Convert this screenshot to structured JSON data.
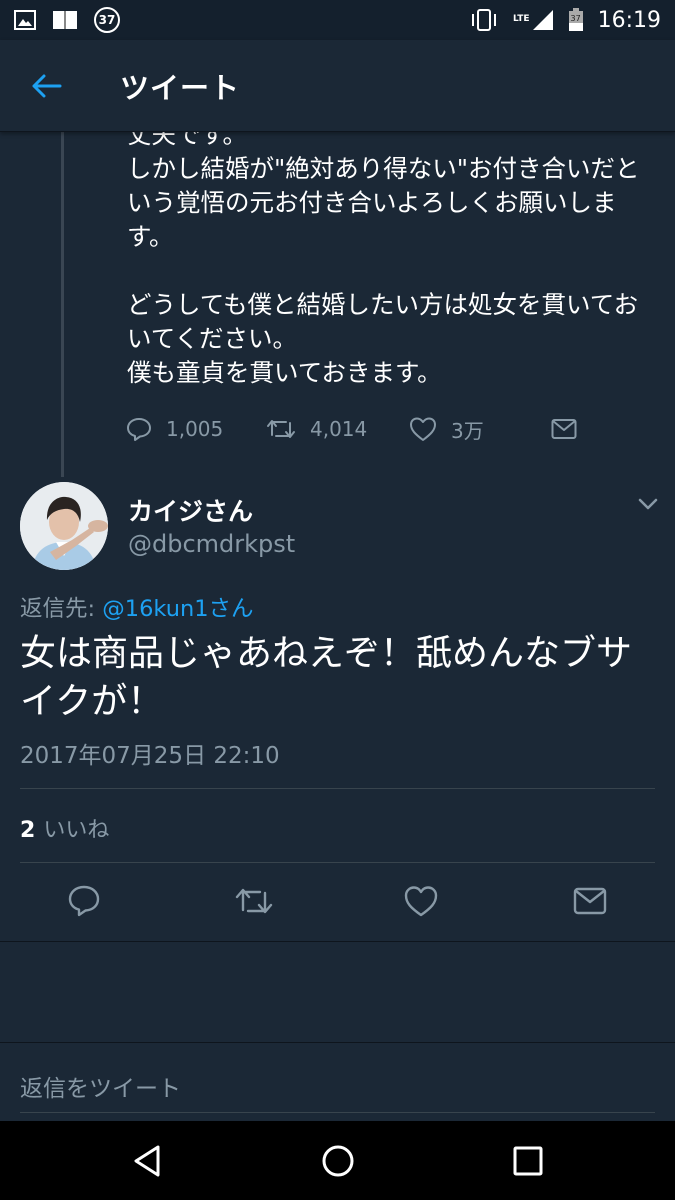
{
  "status_bar": {
    "notification_count": "37",
    "network": "LTE",
    "battery_level": "37",
    "time": "16:19"
  },
  "header": {
    "back_icon": "arrow-left-icon",
    "title": "ツイート"
  },
  "previous_tweet": {
    "text": "丈夫です。\nしかし結婚が\"絶対あり得ない\"お付き合いだという覚悟の元お付き合いよろしくお願いします。\n\nどうしても僕と結婚したい方は処女を貫いておいてください。\n僕も童貞を貫いておきます。",
    "reply_count": "1,005",
    "retweet_count": "4,014",
    "like_count": "3万"
  },
  "tweet": {
    "author_name": "カイジさん",
    "author_handle": "@dbcmdrkpst",
    "reply_label": "返信先:",
    "reply_to": "@16kun1さん",
    "text": "女は商品じゃあねえぞ！舐めんなブサイクが！",
    "date": "2017年07月25日 22:10",
    "like_count": "2",
    "like_label": "いいね"
  },
  "reply_box": {
    "placeholder": "返信をツイート"
  },
  "colors": {
    "background": "#1b2836",
    "accent": "#1da1f2",
    "secondary_text": "#8899a6"
  }
}
